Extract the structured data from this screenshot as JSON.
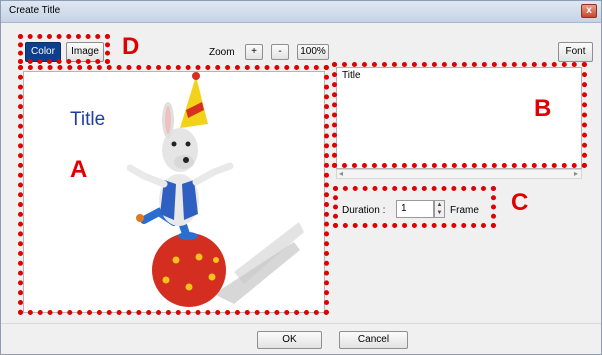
{
  "window": {
    "title": "Create Title",
    "close_label": "x"
  },
  "toolbar": {
    "color_label": "Color",
    "image_label": "Image",
    "zoom_label": "Zoom",
    "zoom_in_label": "+",
    "zoom_out_label": "-",
    "zoom_value_label": "100%",
    "font_label": "Font"
  },
  "preview": {
    "title_text": "Title"
  },
  "text_input": {
    "value": "Title"
  },
  "duration": {
    "label": "Duration :",
    "value": "1",
    "unit": "Frame"
  },
  "footer": {
    "ok_label": "OK",
    "cancel_label": "Cancel"
  },
  "callouts": {
    "a": "A",
    "b": "B",
    "c": "C",
    "d": "D"
  },
  "colors": {
    "callout": "#e00000",
    "selected_button": "#0e3f8c",
    "title_text": "#1f3fa0"
  }
}
